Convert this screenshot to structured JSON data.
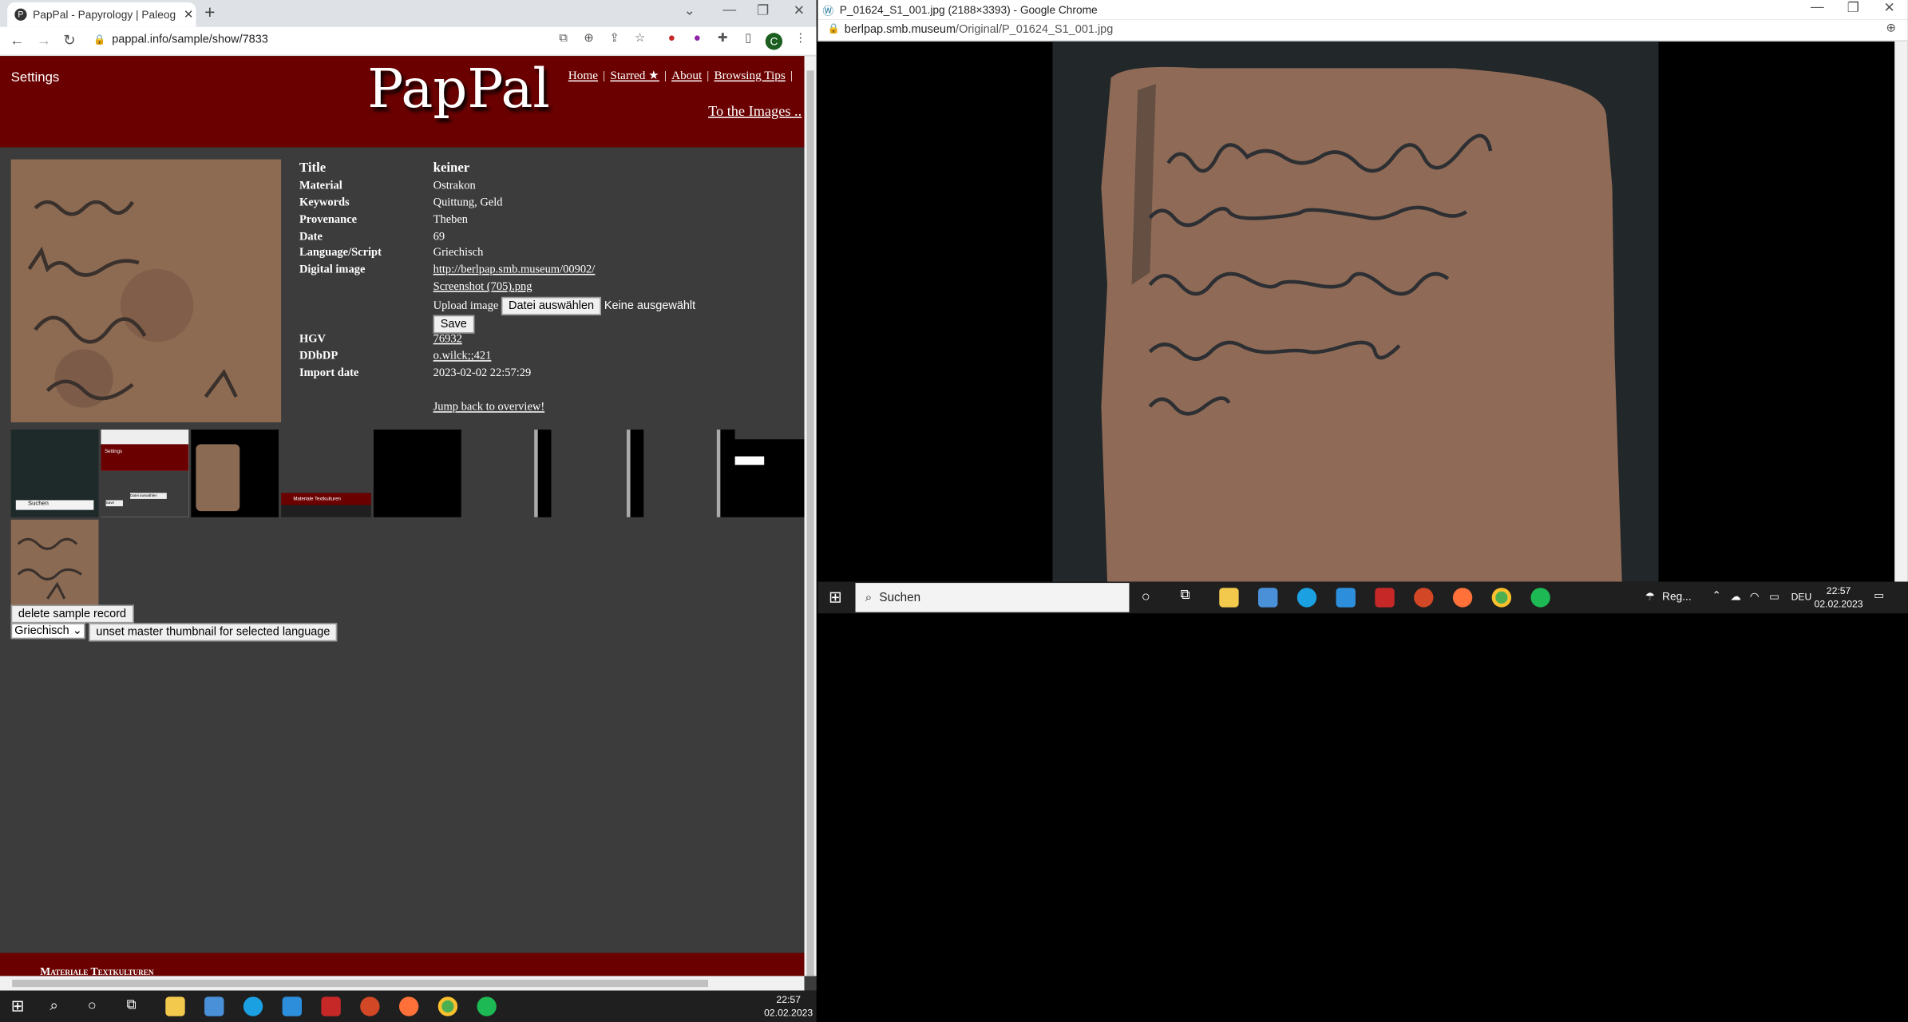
{
  "left_window": {
    "tab_title": "PapPal - Papyrology | Paleograph",
    "favicon_letter": "P",
    "new_tab_symbol": "+",
    "tab_close_symbol": "✕",
    "url": "pappal.info/sample/show/7833",
    "profile_letter": "C"
  },
  "page": {
    "settings": "Settings",
    "logo": "PapPal",
    "nav": [
      "Home",
      "Starred ★",
      "About",
      "Browsing Tips"
    ],
    "nav_sep": "|",
    "to_images": "To the Images ..",
    "title_label": "Title",
    "title_value": "keiner",
    "fields": [
      {
        "label": "Material",
        "value": "Ostrakon"
      },
      {
        "label": "Keywords",
        "value": "Quittung, Geld"
      },
      {
        "label": "Provenance",
        "value": "Theben"
      },
      {
        "label": "Date",
        "value": "69"
      },
      {
        "label": "Language/Script",
        "value": "Griechisch"
      }
    ],
    "digital_image_label": "Digital image",
    "digital_image_link": "http://berlpap.smb.museum/00902/",
    "screenshot_link": "Screenshot (705).png",
    "upload_label": "Upload image",
    "file_button": "Datei auswählen",
    "file_status": "Keine ausgewählt",
    "save_button": "Save",
    "hgv_label": "HGV",
    "hgv_value": "76932",
    "ddbdp_label": "DDbDP",
    "ddbdp_value": "o.wilck;;421",
    "import_label": "Import date",
    "import_value": "2023-02-02 22:57:29",
    "jump_back": "Jump back to overview!",
    "delete_button": "delete sample record",
    "language_select": "Griechisch",
    "unset_button": "unset master thumbnail for selected language",
    "footer": "Materiale Textkulturen",
    "thumb_texts": {
      "suchen": "Suchen",
      "settings": "Settings",
      "file_btn": "Datei auswählen",
      "save": "Save",
      "footer": "Materiale Textkulturen"
    }
  },
  "right_window": {
    "title": "P_01624_S1_001.jpg (2188×3393) - Google Chrome",
    "url_host": "berlpap.smb.museum",
    "url_path": "/Original/P_01624_S1_001.jpg"
  },
  "taskbar": {
    "search_placeholder": "Suchen",
    "weather": "Reg...",
    "lang": "DEU",
    "time": "22:57",
    "date": "02.02.2023"
  },
  "colors": {
    "header_red": "#6b0000",
    "page_bg": "#3c3c3c",
    "ostrakon": "#8a6a52"
  }
}
